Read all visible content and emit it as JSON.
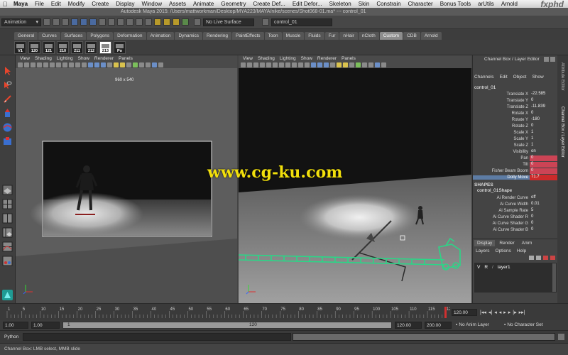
{
  "menubar": {
    "items": [
      "Maya",
      "File",
      "Edit",
      "Modify",
      "Create",
      "Display",
      "Window",
      "Assets",
      "Animate",
      "Geometry",
      "Create Def...",
      "Edit Defor...",
      "Skeleton",
      "Skin",
      "Constrain",
      "Character",
      "Bonus Tools",
      "arUtils",
      "Arnold"
    ],
    "brand": "fxphd"
  },
  "titlebar": {
    "title": "Autodesk Maya 2015: /Users/mattworkman/Desktop/MYA223/MAYA/nike/scenes/Shot068-01.ma*   ---   control_01"
  },
  "toolrow": {
    "menu_set": "Animation",
    "live_surface": "No Live Surface",
    "object_name": "control_01"
  },
  "shelf_tabs": [
    "General",
    "Curves",
    "Surfaces",
    "Polygons",
    "Deformation",
    "Animation",
    "Dynamics",
    "Rendering",
    "PaintEffects",
    "Toon",
    "Muscle",
    "Fluids",
    "Fur",
    "nHair",
    "nCloth",
    "Custom",
    "CDB",
    "Arnold"
  ],
  "shelf_active_tab": "Custom",
  "shelf_buttons": [
    "V1",
    "120",
    "121",
    "210",
    "211",
    "212",
    "213",
    "Po"
  ],
  "viewport_left": {
    "menu": [
      "View",
      "Shading",
      "Lighting",
      "Show",
      "Renderer",
      "Panels"
    ],
    "resolution": "960 x 540"
  },
  "viewport_right": {
    "menu": [
      "View",
      "Shading",
      "Lighting",
      "Show",
      "Renderer",
      "Panels"
    ]
  },
  "watermark": "www.cg-ku.com",
  "channel_box": {
    "header": "Channel Box / Layer Editor",
    "menu": [
      "Channels",
      "Edit",
      "Object",
      "Show"
    ],
    "object": "control_01",
    "channels": [
      {
        "label": "Translate X",
        "value": "-22.585",
        "state": "normal"
      },
      {
        "label": "Translate Y",
        "value": "0",
        "state": "normal"
      },
      {
        "label": "Translate Z",
        "value": "-11.839",
        "state": "normal"
      },
      {
        "label": "Rotate X",
        "value": "0",
        "state": "normal"
      },
      {
        "label": "Rotate Y",
        "value": "-180",
        "state": "normal"
      },
      {
        "label": "Rotate Z",
        "value": "0",
        "state": "normal"
      },
      {
        "label": "Scale X",
        "value": "1",
        "state": "normal"
      },
      {
        "label": "Scale Y",
        "value": "1",
        "state": "normal"
      },
      {
        "label": "Scale Z",
        "value": "1",
        "state": "normal"
      },
      {
        "label": "Visibility",
        "value": "on",
        "state": "normal"
      },
      {
        "label": "Pan",
        "value": "0",
        "state": "key"
      },
      {
        "label": "Tilt",
        "value": "0",
        "state": "key"
      },
      {
        "label": "Fisher Beam Boom",
        "value": "0",
        "state": "key"
      },
      {
        "label": "Dolly Move",
        "value": "71.7",
        "state": "selected"
      }
    ],
    "shapes_label": "SHAPES",
    "shape_name": "control_01Shape",
    "shape_channels": [
      {
        "label": "Ai Render Curve",
        "value": "off"
      },
      {
        "label": "Ai Curve Width",
        "value": "0.01"
      },
      {
        "label": "Ai Sample Rate",
        "value": "5"
      },
      {
        "label": "Ai Curve Shader R",
        "value": "0"
      },
      {
        "label": "Ai Curve Shader G",
        "value": "0"
      },
      {
        "label": "Ai Curve Shader B",
        "value": "0"
      }
    ],
    "layer_tabs": [
      "Display",
      "Render",
      "Anim"
    ],
    "layer_menu": [
      "Layers",
      "Options",
      "Help"
    ],
    "layer": {
      "v": "V",
      "r": "R",
      "name": "layer1"
    },
    "side_tabs": [
      "Attribute Editor",
      "Channel Box / Layer Editor"
    ]
  },
  "timeline": {
    "ticks": [
      "1",
      "5",
      "10",
      "15",
      "20",
      "25",
      "30",
      "35",
      "40",
      "45",
      "50",
      "55",
      "60",
      "65",
      "70",
      "75",
      "80",
      "85",
      "90",
      "95",
      "100",
      "105",
      "110",
      "115",
      "120"
    ],
    "current_frame": "120.00"
  },
  "range": {
    "start": "1.00",
    "anim_start": "1.00",
    "slider_start": "1",
    "slider_end": "120",
    "range_end": "120.00",
    "anim_end": "200.00",
    "anim_layer": "No Anim Layer",
    "character_set": "No Character Set"
  },
  "cmdline": {
    "label": "Python"
  },
  "helpline": {
    "text": "Channel Box: LMB select, MMB slide"
  },
  "colors": {
    "maya_bg": "#444444",
    "selected_channel": "#cc2a2a",
    "keyed_channel": "#cc4455",
    "dolly_track": "#2bd687",
    "watermark": "#f2e00c"
  }
}
